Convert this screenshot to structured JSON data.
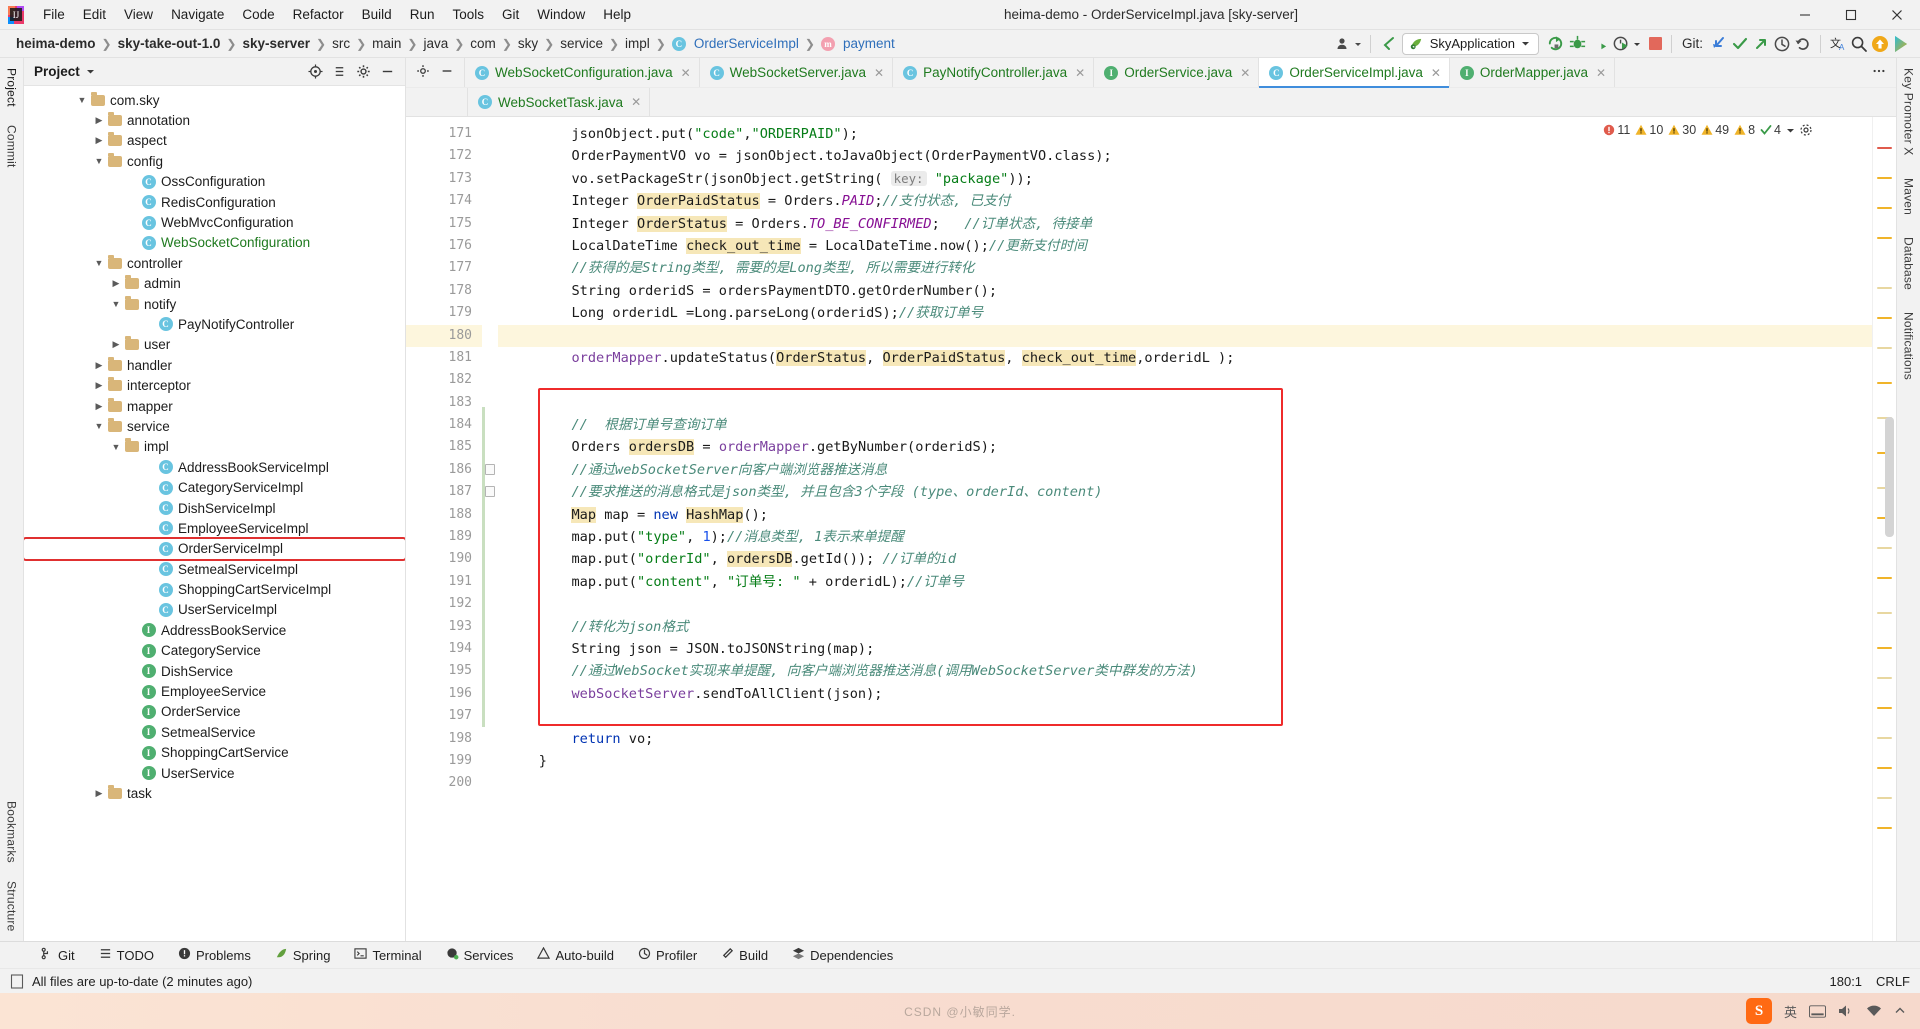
{
  "window": {
    "title": "heima-demo - OrderServiceImpl.java [sky-server]",
    "minimize": "—",
    "maximize": "❐",
    "close": "✕"
  },
  "menu": [
    "File",
    "Edit",
    "View",
    "Navigate",
    "Code",
    "Refactor",
    "Build",
    "Run",
    "Tools",
    "Git",
    "Window",
    "Help"
  ],
  "breadcrumb": [
    {
      "label": "heima-demo",
      "style": "bold"
    },
    {
      "label": "sky-take-out-1.0",
      "style": "bold"
    },
    {
      "label": "sky-server",
      "style": "bold"
    },
    {
      "label": "src",
      "style": "plain"
    },
    {
      "label": "main",
      "style": "plain"
    },
    {
      "label": "java",
      "style": "plain"
    },
    {
      "label": "com",
      "style": "plain"
    },
    {
      "label": "sky",
      "style": "plain"
    },
    {
      "label": "service",
      "style": "plain"
    },
    {
      "label": "impl",
      "style": "plain"
    },
    {
      "label": "OrderServiceImpl",
      "style": "blue",
      "icon": "class-icon"
    },
    {
      "label": "payment",
      "style": "blue",
      "icon": "method-icon"
    }
  ],
  "toolbar": {
    "run_config": "SkyApplication",
    "git_label": "Git:",
    "icons": [
      "user-icon",
      "back-arrow-icon",
      "run-icon",
      "debug-icon",
      "coverage-icon",
      "profile-icon",
      "stop-icon",
      "git-update-icon",
      "git-commit-icon",
      "git-push-icon",
      "git-history-icon",
      "git-rollback-icon",
      "translate-icon",
      "search-everywhere-icon",
      "updates-icon",
      "ide-icon"
    ]
  },
  "project_panel": {
    "title": "Project",
    "tree": [
      {
        "indent": 3,
        "arrow": "down",
        "icon": "folder",
        "label": "com.sky"
      },
      {
        "indent": 4,
        "arrow": "right",
        "icon": "folder",
        "label": "annotation"
      },
      {
        "indent": 4,
        "arrow": "right",
        "icon": "folder",
        "label": "aspect"
      },
      {
        "indent": 4,
        "arrow": "down",
        "icon": "folder",
        "label": "config"
      },
      {
        "indent": 6,
        "arrow": "none",
        "icon": "class",
        "label": "OssConfiguration"
      },
      {
        "indent": 6,
        "arrow": "none",
        "icon": "class",
        "label": "RedisConfiguration"
      },
      {
        "indent": 6,
        "arrow": "none",
        "icon": "class",
        "label": "WebMvcConfiguration"
      },
      {
        "indent": 6,
        "arrow": "none",
        "icon": "class",
        "label": "WebSocketConfiguration",
        "color": "green"
      },
      {
        "indent": 4,
        "arrow": "down",
        "icon": "folder",
        "label": "controller"
      },
      {
        "indent": 5,
        "arrow": "right",
        "icon": "folder",
        "label": "admin"
      },
      {
        "indent": 5,
        "arrow": "down",
        "icon": "folder",
        "label": "notify"
      },
      {
        "indent": 7,
        "arrow": "none",
        "icon": "class",
        "label": "PayNotifyController"
      },
      {
        "indent": 5,
        "arrow": "right",
        "icon": "folder",
        "label": "user"
      },
      {
        "indent": 4,
        "arrow": "right",
        "icon": "folder",
        "label": "handler"
      },
      {
        "indent": 4,
        "arrow": "right",
        "icon": "folder",
        "label": "interceptor"
      },
      {
        "indent": 4,
        "arrow": "right",
        "icon": "folder",
        "label": "mapper"
      },
      {
        "indent": 4,
        "arrow": "down",
        "icon": "folder",
        "label": "service"
      },
      {
        "indent": 5,
        "arrow": "down",
        "icon": "folder",
        "label": "impl"
      },
      {
        "indent": 7,
        "arrow": "none",
        "icon": "class",
        "label": "AddressBookServiceImpl"
      },
      {
        "indent": 7,
        "arrow": "none",
        "icon": "class",
        "label": "CategoryServiceImpl"
      },
      {
        "indent": 7,
        "arrow": "none",
        "icon": "class",
        "label": "DishServiceImpl"
      },
      {
        "indent": 7,
        "arrow": "none",
        "icon": "class",
        "label": "EmployeeServiceImpl"
      },
      {
        "indent": 7,
        "arrow": "none",
        "icon": "class",
        "label": "OrderServiceImpl",
        "selected": true
      },
      {
        "indent": 7,
        "arrow": "none",
        "icon": "class",
        "label": "SetmealServiceImpl"
      },
      {
        "indent": 7,
        "arrow": "none",
        "icon": "class",
        "label": "ShoppingCartServiceImpl"
      },
      {
        "indent": 7,
        "arrow": "none",
        "icon": "class",
        "label": "UserServiceImpl"
      },
      {
        "indent": 6,
        "arrow": "none",
        "icon": "iface",
        "label": "AddressBookService"
      },
      {
        "indent": 6,
        "arrow": "none",
        "icon": "iface",
        "label": "CategoryService"
      },
      {
        "indent": 6,
        "arrow": "none",
        "icon": "iface",
        "label": "DishService"
      },
      {
        "indent": 6,
        "arrow": "none",
        "icon": "iface",
        "label": "EmployeeService"
      },
      {
        "indent": 6,
        "arrow": "none",
        "icon": "iface",
        "label": "OrderService"
      },
      {
        "indent": 6,
        "arrow": "none",
        "icon": "iface",
        "label": "SetmealService"
      },
      {
        "indent": 6,
        "arrow": "none",
        "icon": "iface",
        "label": "ShoppingCartService"
      },
      {
        "indent": 6,
        "arrow": "none",
        "icon": "iface",
        "label": "UserService"
      },
      {
        "indent": 4,
        "arrow": "right",
        "icon": "folder",
        "label": "task"
      }
    ]
  },
  "tabs_row1": [
    {
      "label": "WebSocketConfiguration.java",
      "icon": "class-icon",
      "active": false
    },
    {
      "label": "WebSocketServer.java",
      "icon": "class-icon",
      "active": false
    },
    {
      "label": "PayNotifyController.java",
      "icon": "class-icon",
      "active": false
    },
    {
      "label": "OrderService.java",
      "icon": "iface-icon",
      "active": false
    },
    {
      "label": "OrderServiceImpl.java",
      "icon": "class-icon",
      "active": true
    },
    {
      "label": "OrderMapper.java",
      "icon": "iface-icon",
      "active": false
    }
  ],
  "tabs_row2": [
    {
      "label": "WebSocketTask.java",
      "icon": "class-icon",
      "active": false
    }
  ],
  "inspection": {
    "errors": "11",
    "warnings1": "10",
    "warnings2": "30",
    "warnings3": "49",
    "warnings4": "8",
    "oks": "4"
  },
  "editor": {
    "first_line": 171,
    "current_line": 180,
    "lines": [
      {
        "n": 171,
        "code": "        jsonObject.put(\"code\",\"ORDERPAID\");"
      },
      {
        "n": 172,
        "code": "        OrderPaymentVO vo = jsonObject.toJavaObject(OrderPaymentVO.class);"
      },
      {
        "n": 173,
        "code": "        vo.setPackageStr(jsonObject.getString( key: \"package\"));"
      },
      {
        "n": 174,
        "code": "        Integer OrderPaidStatus = Orders.PAID;//支付状态, 已支付"
      },
      {
        "n": 175,
        "code": "        Integer OrderStatus = Orders.TO_BE_CONFIRMED;   //订单状态, 待接单"
      },
      {
        "n": 176,
        "code": "        LocalDateTime check_out_time = LocalDateTime.now();//更新支付时间"
      },
      {
        "n": 177,
        "code": "        //获得的是String类型, 需要的是Long类型, 所以需要进行转化"
      },
      {
        "n": 178,
        "code": "        String orderidS = ordersPaymentDTO.getOrderNumber();"
      },
      {
        "n": 179,
        "code": "        Long orderidL =Long.parseLong(orderidS);//获取订单号"
      },
      {
        "n": 180,
        "code": ""
      },
      {
        "n": 181,
        "code": "        orderMapper.updateStatus(OrderStatus, OrderPaidStatus, check_out_time,orderidL );"
      },
      {
        "n": 182,
        "code": ""
      },
      {
        "n": 183,
        "code": ""
      },
      {
        "n": 184,
        "code": "        //  根据订单号查询订单"
      },
      {
        "n": 185,
        "code": "        Orders ordersDB = orderMapper.getByNumber(orderidS);"
      },
      {
        "n": 186,
        "code": "        //通过webSocketServer向客户端浏览器推送消息"
      },
      {
        "n": 187,
        "code": "        //要求推送的消息格式是json类型, 并且包含3个字段 (type、orderId、content)"
      },
      {
        "n": 188,
        "code": "        Map map = new HashMap();"
      },
      {
        "n": 189,
        "code": "        map.put(\"type\", 1);//消息类型, 1表示来单提醒"
      },
      {
        "n": 190,
        "code": "        map.put(\"orderId\", ordersDB.getId()); //订单的id"
      },
      {
        "n": 191,
        "code": "        map.put(\"content\", \"订单号: \" + orderidL);//订单号"
      },
      {
        "n": 192,
        "code": ""
      },
      {
        "n": 193,
        "code": "        //转化为json格式"
      },
      {
        "n": 194,
        "code": "        String json = JSON.toJSONString(map);"
      },
      {
        "n": 195,
        "code": "        //通过WebSocket实现来单提醒, 向客户端浏览器推送消息(调用WebSocketServer类中群发的方法)"
      },
      {
        "n": 196,
        "code": "        webSocketServer.sendToAllClient(json);"
      },
      {
        "n": 197,
        "code": ""
      },
      {
        "n": 198,
        "code": "        return vo;"
      },
      {
        "n": 199,
        "code": "    }"
      },
      {
        "n": 200,
        "code": ""
      }
    ]
  },
  "tool_windows": [
    {
      "label": "Git",
      "icon": "git-branch-icon"
    },
    {
      "label": "TODO",
      "icon": "todo-list-icon"
    },
    {
      "label": "Problems",
      "icon": "problems-icon"
    },
    {
      "label": "Spring",
      "icon": "spring-leaf-icon"
    },
    {
      "label": "Terminal",
      "icon": "terminal-icon"
    },
    {
      "label": "Services",
      "icon": "services-icon"
    },
    {
      "label": "Auto-build",
      "icon": "warning-triangle-icon"
    },
    {
      "label": "Profiler",
      "icon": "profiler-icon"
    },
    {
      "label": "Build",
      "icon": "hammer-icon"
    },
    {
      "label": "Dependencies",
      "icon": "dependencies-icon"
    }
  ],
  "status": {
    "message": "All files are up-to-date (2 minutes ago)",
    "caret": "180:1",
    "line_sep": "CRLF"
  },
  "rails": {
    "left_top": [
      "Project",
      "Commit"
    ],
    "left_bottom": [
      "Bookmarks",
      "Structure"
    ],
    "right_top": [
      "Key Promoter X",
      "Maven",
      "Database",
      "Notifications"
    ]
  },
  "tray": {
    "ime": "英",
    "watermark": "CSDN @小敏同学.",
    "icons": [
      "sogou-icon",
      "keyboard-icon",
      "volume-icon",
      "network-icon",
      "tray-expand-icon"
    ]
  },
  "colors": {
    "accent_blue": "#2f6fba",
    "tab_green": "#1f7a1f",
    "highlight_red": "#ef2b2b",
    "string_green": "#067d17",
    "keyword_blue": "#0033b3",
    "comment_gray": "#8c8c8c",
    "comment_cn": "#4a8a7a",
    "method_purple": "#7a3e9d",
    "search_hl": "#f6e7b8"
  }
}
